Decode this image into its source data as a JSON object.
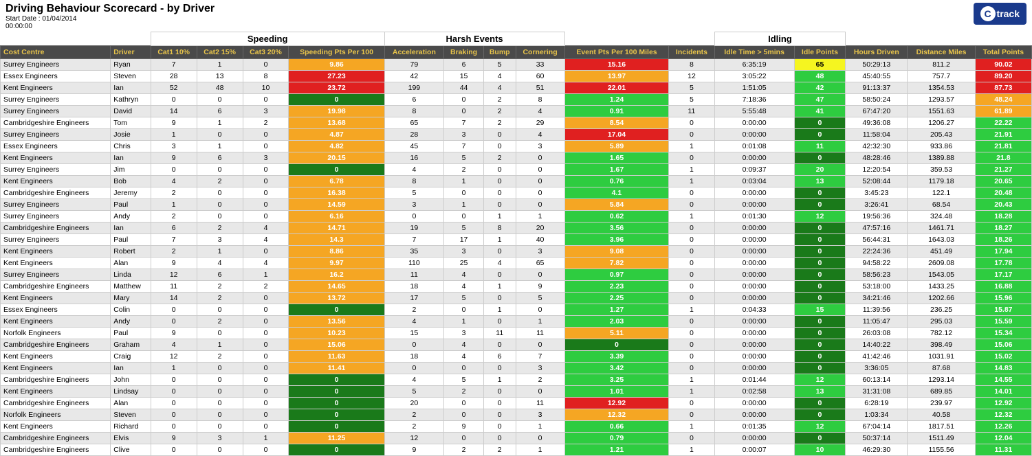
{
  "title": "Driving Behaviour Scorecard - by Driver",
  "startDate": "Start Date : 01/04/2014",
  "startTime": "00:00:00",
  "logo": {
    "letter": "C",
    "text": "track"
  },
  "sectionHeaders": {
    "speeding": "Speeding",
    "harsh": "Harsh Events",
    "idling": "Idling"
  },
  "columnHeaders": {
    "costCentre": "Cost Centre",
    "driver": "Driver",
    "cat1": "Cat1 10%",
    "cat2": "Cat2 15%",
    "cat3": "Cat3 20%",
    "speedingPts": "Speeding Pts Per 100",
    "acceleration": "Acceleration",
    "braking": "Braking",
    "bump": "Bump",
    "cornering": "Cornering",
    "eventPts": "Event Pts Per 100 Miles",
    "incidents": "Incidents",
    "idleTime": "Idle Time > 5mins",
    "idlePoints": "Idle Points",
    "hoursDriven": "Hours Driven",
    "distanceMiles": "Distance Miles",
    "totalPoints": "Total Points"
  },
  "rows": [
    {
      "costCentre": "Surrey Engineers",
      "driver": "Ryan",
      "cat1": 7,
      "cat2": 1,
      "cat3": 0,
      "speedingPts": "9.86",
      "speedingColor": "orange",
      "acceleration": 79,
      "braking": 6,
      "bump": 5,
      "cornering": 33,
      "eventPts": "15.16",
      "eventColor": "red",
      "incidents": 8,
      "idleTime": "6:35:19",
      "idlePoints": 65,
      "idleColor": "yellow",
      "hoursDriven": "50:29:13",
      "distanceMiles": "811.2",
      "totalPoints": "90.02",
      "totalColor": "red"
    },
    {
      "costCentre": "Essex Engineers",
      "driver": "Steven",
      "cat1": 28,
      "cat2": 13,
      "cat3": 8,
      "speedingPts": "27.23",
      "speedingColor": "red",
      "acceleration": 42,
      "braking": 15,
      "bump": 4,
      "cornering": 60,
      "eventPts": "13.97",
      "eventColor": "orange",
      "incidents": 12,
      "idleTime": "3:05:22",
      "idlePoints": 48,
      "idleColor": "green",
      "hoursDriven": "45:40:55",
      "distanceMiles": "757.7",
      "totalPoints": "89.20",
      "totalColor": "red"
    },
    {
      "costCentre": "Kent Engineers",
      "driver": "Ian",
      "cat1": 52,
      "cat2": 48,
      "cat3": 10,
      "speedingPts": "23.72",
      "speedingColor": "red",
      "acceleration": 199,
      "braking": 44,
      "bump": 4,
      "cornering": 51,
      "eventPts": "22.01",
      "eventColor": "red",
      "incidents": 5,
      "idleTime": "1:51:05",
      "idlePoints": 42,
      "idleColor": "green",
      "hoursDriven": "91:13:37",
      "distanceMiles": "1354.53",
      "totalPoints": "87.73",
      "totalColor": "red"
    },
    {
      "costCentre": "Surrey Engineers",
      "driver": "Kathryn",
      "cat1": 0,
      "cat2": 0,
      "cat3": 0,
      "speedingPts": "0",
      "speedingColor": "dark-green",
      "acceleration": 6,
      "braking": 0,
      "bump": 2,
      "cornering": 8,
      "eventPts": "1.24",
      "eventColor": "green",
      "incidents": 5,
      "idleTime": "7:18:36",
      "idlePoints": 47,
      "idleColor": "green",
      "hoursDriven": "58:50:24",
      "distanceMiles": "1293.57",
      "totalPoints": "48.24",
      "totalColor": "orange"
    },
    {
      "costCentre": "Surrey Engineers",
      "driver": "David",
      "cat1": 14,
      "cat2": 6,
      "cat3": 3,
      "speedingPts": "19.98",
      "speedingColor": "orange",
      "acceleration": 8,
      "braking": 0,
      "bump": 2,
      "cornering": 4,
      "eventPts": "0.91",
      "eventColor": "green",
      "incidents": 11,
      "idleTime": "5:55:48",
      "idlePoints": 41,
      "idleColor": "green",
      "hoursDriven": "67:47:20",
      "distanceMiles": "1551.63",
      "totalPoints": "61.89",
      "totalColor": "orange"
    },
    {
      "costCentre": "Cambridgeshire Engineers",
      "driver": "Tom",
      "cat1": 9,
      "cat2": 1,
      "cat3": 2,
      "speedingPts": "13.68",
      "speedingColor": "orange",
      "acceleration": 65,
      "braking": 7,
      "bump": 2,
      "cornering": 29,
      "eventPts": "8.54",
      "eventColor": "orange",
      "incidents": 0,
      "idleTime": "0:00:00",
      "idlePoints": 0,
      "idleColor": "dark-green",
      "hoursDriven": "49:36:08",
      "distanceMiles": "1206.27",
      "totalPoints": "22.22",
      "totalColor": "green"
    },
    {
      "costCentre": "Surrey Engineers",
      "driver": "Josie",
      "cat1": 1,
      "cat2": 0,
      "cat3": 0,
      "speedingPts": "4.87",
      "speedingColor": "orange",
      "acceleration": 28,
      "braking": 3,
      "bump": 0,
      "cornering": 4,
      "eventPts": "17.04",
      "eventColor": "red",
      "incidents": 0,
      "idleTime": "0:00:00",
      "idlePoints": 0,
      "idleColor": "dark-green",
      "hoursDriven": "11:58:04",
      "distanceMiles": "205.43",
      "totalPoints": "21.91",
      "totalColor": "green"
    },
    {
      "costCentre": "Essex Engineers",
      "driver": "Chris",
      "cat1": 3,
      "cat2": 1,
      "cat3": 0,
      "speedingPts": "4.82",
      "speedingColor": "orange",
      "acceleration": 45,
      "braking": 7,
      "bump": 0,
      "cornering": 3,
      "eventPts": "5.89",
      "eventColor": "orange",
      "incidents": 1,
      "idleTime": "0:01:08",
      "idlePoints": 11,
      "idleColor": "green",
      "hoursDriven": "42:32:30",
      "distanceMiles": "933.86",
      "totalPoints": "21.81",
      "totalColor": "green"
    },
    {
      "costCentre": "Kent Engineers",
      "driver": "Ian",
      "cat1": 9,
      "cat2": 6,
      "cat3": 3,
      "speedingPts": "20.15",
      "speedingColor": "orange",
      "acceleration": 16,
      "braking": 5,
      "bump": 2,
      "cornering": 0,
      "eventPts": "1.65",
      "eventColor": "green",
      "incidents": 0,
      "idleTime": "0:00:00",
      "idlePoints": 0,
      "idleColor": "dark-green",
      "hoursDriven": "48:28:46",
      "distanceMiles": "1389.88",
      "totalPoints": "21.8",
      "totalColor": "green"
    },
    {
      "costCentre": "Surrey Engineers",
      "driver": "Jim",
      "cat1": 0,
      "cat2": 0,
      "cat3": 0,
      "speedingPts": "0",
      "speedingColor": "dark-green",
      "acceleration": 4,
      "braking": 2,
      "bump": 0,
      "cornering": 0,
      "eventPts": "1.67",
      "eventColor": "green",
      "incidents": 1,
      "idleTime": "0:09:37",
      "idlePoints": 20,
      "idleColor": "green",
      "hoursDriven": "12:20:54",
      "distanceMiles": "359.53",
      "totalPoints": "21.27",
      "totalColor": "green"
    },
    {
      "costCentre": "Kent Engineers",
      "driver": "Bob",
      "cat1": 4,
      "cat2": 2,
      "cat3": 0,
      "speedingPts": "6.78",
      "speedingColor": "orange",
      "acceleration": 8,
      "braking": 1,
      "bump": 0,
      "cornering": 0,
      "eventPts": "0.76",
      "eventColor": "green",
      "incidents": 1,
      "idleTime": "0:03:04",
      "idlePoints": 13,
      "idleColor": "green",
      "hoursDriven": "52:08:44",
      "distanceMiles": "1179.18",
      "totalPoints": "20.65",
      "totalColor": "green"
    },
    {
      "costCentre": "Cambridgeshire Engineers",
      "driver": "Jeremy",
      "cat1": 2,
      "cat2": 0,
      "cat3": 0,
      "speedingPts": "16.38",
      "speedingColor": "orange",
      "acceleration": 5,
      "braking": 0,
      "bump": 0,
      "cornering": 0,
      "eventPts": "4.1",
      "eventColor": "green",
      "incidents": 0,
      "idleTime": "0:00:00",
      "idlePoints": 0,
      "idleColor": "dark-green",
      "hoursDriven": "3:45:23",
      "distanceMiles": "122.1",
      "totalPoints": "20.48",
      "totalColor": "green"
    },
    {
      "costCentre": "Surrey Engineers",
      "driver": "Paul",
      "cat1": 1,
      "cat2": 0,
      "cat3": 0,
      "speedingPts": "14.59",
      "speedingColor": "orange",
      "acceleration": 3,
      "braking": 1,
      "bump": 0,
      "cornering": 0,
      "eventPts": "5.84",
      "eventColor": "orange",
      "incidents": 0,
      "idleTime": "0:00:00",
      "idlePoints": 0,
      "idleColor": "dark-green",
      "hoursDriven": "3:26:41",
      "distanceMiles": "68.54",
      "totalPoints": "20.43",
      "totalColor": "green"
    },
    {
      "costCentre": "Surrey Engineers",
      "driver": "Andy",
      "cat1": 2,
      "cat2": 0,
      "cat3": 0,
      "speedingPts": "6.16",
      "speedingColor": "orange",
      "acceleration": 0,
      "braking": 0,
      "bump": 1,
      "cornering": 1,
      "eventPts": "0.62",
      "eventColor": "green",
      "incidents": 1,
      "idleTime": "0:01:30",
      "idlePoints": 12,
      "idleColor": "green",
      "hoursDriven": "19:56:36",
      "distanceMiles": "324.48",
      "totalPoints": "18.28",
      "totalColor": "green"
    },
    {
      "costCentre": "Cambridgeshire Engineers",
      "driver": "Ian",
      "cat1": 6,
      "cat2": 2,
      "cat3": 4,
      "speedingPts": "14.71",
      "speedingColor": "orange",
      "acceleration": 19,
      "braking": 5,
      "bump": 8,
      "cornering": 20,
      "eventPts": "3.56",
      "eventColor": "green",
      "incidents": 0,
      "idleTime": "0:00:00",
      "idlePoints": 0,
      "idleColor": "dark-green",
      "hoursDriven": "47:57:16",
      "distanceMiles": "1461.71",
      "totalPoints": "18.27",
      "totalColor": "green"
    },
    {
      "costCentre": "Surrey Engineers",
      "driver": "Paul",
      "cat1": 7,
      "cat2": 3,
      "cat3": 4,
      "speedingPts": "14.3",
      "speedingColor": "orange",
      "acceleration": 7,
      "braking": 17,
      "bump": 1,
      "cornering": 40,
      "eventPts": "3.96",
      "eventColor": "green",
      "incidents": 0,
      "idleTime": "0:00:00",
      "idlePoints": 0,
      "idleColor": "dark-green",
      "hoursDriven": "56:44:31",
      "distanceMiles": "1643.03",
      "totalPoints": "18.26",
      "totalColor": "green"
    },
    {
      "costCentre": "Kent Engineers",
      "driver": "Robert",
      "cat1": 2,
      "cat2": 1,
      "cat3": 0,
      "speedingPts": "8.86",
      "speedingColor": "orange",
      "acceleration": 35,
      "braking": 3,
      "bump": 0,
      "cornering": 3,
      "eventPts": "9.08",
      "eventColor": "orange",
      "incidents": 0,
      "idleTime": "0:00:00",
      "idlePoints": 0,
      "idleColor": "dark-green",
      "hoursDriven": "22:24:36",
      "distanceMiles": "451.49",
      "totalPoints": "17.94",
      "totalColor": "green"
    },
    {
      "costCentre": "Kent Engineers",
      "driver": "Alan",
      "cat1": 9,
      "cat2": 4,
      "cat3": 4,
      "speedingPts": "9.97",
      "speedingColor": "orange",
      "acceleration": 110,
      "braking": 25,
      "bump": 4,
      "cornering": 65,
      "eventPts": "7.82",
      "eventColor": "orange",
      "incidents": 0,
      "idleTime": "0:00:00",
      "idlePoints": 0,
      "idleColor": "dark-green",
      "hoursDriven": "94:58:22",
      "distanceMiles": "2609.08",
      "totalPoints": "17.78",
      "totalColor": "green"
    },
    {
      "costCentre": "Surrey Engineers",
      "driver": "Linda",
      "cat1": 12,
      "cat2": 6,
      "cat3": 1,
      "speedingPts": "16.2",
      "speedingColor": "orange",
      "acceleration": 11,
      "braking": 4,
      "bump": 0,
      "cornering": 0,
      "eventPts": "0.97",
      "eventColor": "green",
      "incidents": 0,
      "idleTime": "0:00:00",
      "idlePoints": 0,
      "idleColor": "dark-green",
      "hoursDriven": "58:56:23",
      "distanceMiles": "1543.05",
      "totalPoints": "17.17",
      "totalColor": "green"
    },
    {
      "costCentre": "Cambridgeshire Engineers",
      "driver": "Matthew",
      "cat1": 11,
      "cat2": 2,
      "cat3": 2,
      "speedingPts": "14.65",
      "speedingColor": "orange",
      "acceleration": 18,
      "braking": 4,
      "bump": 1,
      "cornering": 9,
      "eventPts": "2.23",
      "eventColor": "green",
      "incidents": 0,
      "idleTime": "0:00:00",
      "idlePoints": 0,
      "idleColor": "dark-green",
      "hoursDriven": "53:18:00",
      "distanceMiles": "1433.25",
      "totalPoints": "16.88",
      "totalColor": "green"
    },
    {
      "costCentre": "Kent Engineers",
      "driver": "Mary",
      "cat1": 14,
      "cat2": 2,
      "cat3": 0,
      "speedingPts": "13.72",
      "speedingColor": "orange",
      "acceleration": 17,
      "braking": 5,
      "bump": 0,
      "cornering": 5,
      "eventPts": "2.25",
      "eventColor": "green",
      "incidents": 0,
      "idleTime": "0:00:00",
      "idlePoints": 0,
      "idleColor": "dark-green",
      "hoursDriven": "34:21:46",
      "distanceMiles": "1202.66",
      "totalPoints": "15.96",
      "totalColor": "green"
    },
    {
      "costCentre": "Essex Engineers",
      "driver": "Colin",
      "cat1": 0,
      "cat2": 0,
      "cat3": 0,
      "speedingPts": "0",
      "speedingColor": "dark-green",
      "acceleration": 2,
      "braking": 0,
      "bump": 1,
      "cornering": 0,
      "eventPts": "1.27",
      "eventColor": "green",
      "incidents": 1,
      "idleTime": "0:04:33",
      "idlePoints": 15,
      "idleColor": "green",
      "hoursDriven": "11:39:56",
      "distanceMiles": "236.25",
      "totalPoints": "15.87",
      "totalColor": "green"
    },
    {
      "costCentre": "Kent Engineers",
      "driver": "Andy",
      "cat1": 0,
      "cat2": 2,
      "cat3": 0,
      "speedingPts": "13.56",
      "speedingColor": "orange",
      "acceleration": 4,
      "braking": 1,
      "bump": 0,
      "cornering": 1,
      "eventPts": "2.03",
      "eventColor": "green",
      "incidents": 0,
      "idleTime": "0:00:00",
      "idlePoints": 0,
      "idleColor": "dark-green",
      "hoursDriven": "11:05:47",
      "distanceMiles": "295.03",
      "totalPoints": "15.59",
      "totalColor": "green"
    },
    {
      "costCentre": "Norfolk Engineers",
      "driver": "Paul",
      "cat1": 9,
      "cat2": 0,
      "cat3": 0,
      "speedingPts": "10.23",
      "speedingColor": "orange",
      "acceleration": 15,
      "braking": 3,
      "bump": 11,
      "cornering": 11,
      "eventPts": "5.11",
      "eventColor": "orange",
      "incidents": 0,
      "idleTime": "0:00:00",
      "idlePoints": 0,
      "idleColor": "dark-green",
      "hoursDriven": "26:03:08",
      "distanceMiles": "782.12",
      "totalPoints": "15.34",
      "totalColor": "green"
    },
    {
      "costCentre": "Cambridgeshire Engineers",
      "driver": "Graham",
      "cat1": 4,
      "cat2": 1,
      "cat3": 0,
      "speedingPts": "15.06",
      "speedingColor": "orange",
      "acceleration": 0,
      "braking": 4,
      "bump": 0,
      "cornering": 0,
      "eventPts": "0",
      "eventColor": "dark-green",
      "incidents": 0,
      "idleTime": "0:00:00",
      "idlePoints": 0,
      "idleColor": "dark-green",
      "hoursDriven": "14:40:22",
      "distanceMiles": "398.49",
      "totalPoints": "15.06",
      "totalColor": "green"
    },
    {
      "costCentre": "Kent Engineers",
      "driver": "Craig",
      "cat1": 12,
      "cat2": 2,
      "cat3": 0,
      "speedingPts": "11.63",
      "speedingColor": "orange",
      "acceleration": 18,
      "braking": 4,
      "bump": 6,
      "cornering": 7,
      "eventPts": "3.39",
      "eventColor": "green",
      "incidents": 0,
      "idleTime": "0:00:00",
      "idlePoints": 0,
      "idleColor": "dark-green",
      "hoursDriven": "41:42:46",
      "distanceMiles": "1031.91",
      "totalPoints": "15.02",
      "totalColor": "green"
    },
    {
      "costCentre": "Kent Engineers",
      "driver": "Ian",
      "cat1": 1,
      "cat2": 0,
      "cat3": 0,
      "speedingPts": "11.41",
      "speedingColor": "orange",
      "acceleration": 0,
      "braking": 0,
      "bump": 0,
      "cornering": 3,
      "eventPts": "3.42",
      "eventColor": "green",
      "incidents": 0,
      "idleTime": "0:00:00",
      "idlePoints": 0,
      "idleColor": "dark-green",
      "hoursDriven": "3:36:05",
      "distanceMiles": "87.68",
      "totalPoints": "14.83",
      "totalColor": "green"
    },
    {
      "costCentre": "Cambridgeshire Engineers",
      "driver": "John",
      "cat1": 0,
      "cat2": 0,
      "cat3": 0,
      "speedingPts": "0",
      "speedingColor": "dark-green",
      "acceleration": 4,
      "braking": 5,
      "bump": 1,
      "cornering": 2,
      "eventPts": "3.25",
      "eventColor": "green",
      "incidents": 1,
      "idleTime": "0:01:44",
      "idlePoints": 12,
      "idleColor": "green",
      "hoursDriven": "60:13:14",
      "distanceMiles": "1293.14",
      "totalPoints": "14.55",
      "totalColor": "green"
    },
    {
      "costCentre": "Kent Engineers",
      "driver": "Lindsay",
      "cat1": 0,
      "cat2": 0,
      "cat3": 0,
      "speedingPts": "0",
      "speedingColor": "dark-green",
      "acceleration": 5,
      "braking": 2,
      "bump": 0,
      "cornering": 0,
      "eventPts": "1.01",
      "eventColor": "green",
      "incidents": 1,
      "idleTime": "0:02:58",
      "idlePoints": 13,
      "idleColor": "green",
      "hoursDriven": "31:31:08",
      "distanceMiles": "689.85",
      "totalPoints": "14.01",
      "totalColor": "green"
    },
    {
      "costCentre": "Cambridgeshire Engineers",
      "driver": "Alan",
      "cat1": 0,
      "cat2": 0,
      "cat3": 0,
      "speedingPts": "0",
      "speedingColor": "dark-green",
      "acceleration": 20,
      "braking": 0,
      "bump": 0,
      "cornering": 11,
      "eventPts": "12.92",
      "eventColor": "red",
      "incidents": 0,
      "idleTime": "0:00:00",
      "idlePoints": 0,
      "idleColor": "dark-green",
      "hoursDriven": "6:28:19",
      "distanceMiles": "239.97",
      "totalPoints": "12.92",
      "totalColor": "green"
    },
    {
      "costCentre": "Norfolk Engineers",
      "driver": "Steven",
      "cat1": 0,
      "cat2": 0,
      "cat3": 0,
      "speedingPts": "0",
      "speedingColor": "dark-green",
      "acceleration": 2,
      "braking": 0,
      "bump": 0,
      "cornering": 3,
      "eventPts": "12.32",
      "eventColor": "orange",
      "incidents": 0,
      "idleTime": "0:00:00",
      "idlePoints": 0,
      "idleColor": "dark-green",
      "hoursDriven": "1:03:34",
      "distanceMiles": "40.58",
      "totalPoints": "12.32",
      "totalColor": "green"
    },
    {
      "costCentre": "Kent Engineers",
      "driver": "Richard",
      "cat1": 0,
      "cat2": 0,
      "cat3": 0,
      "speedingPts": "0",
      "speedingColor": "dark-green",
      "acceleration": 2,
      "braking": 9,
      "bump": 0,
      "cornering": 1,
      "eventPts": "0.66",
      "eventColor": "green",
      "incidents": 1,
      "idleTime": "0:01:35",
      "idlePoints": 12,
      "idleColor": "green",
      "hoursDriven": "67:04:14",
      "distanceMiles": "1817.51",
      "totalPoints": "12.26",
      "totalColor": "green"
    },
    {
      "costCentre": "Cambridgeshire Engineers",
      "driver": "Elvis",
      "cat1": 9,
      "cat2": 3,
      "cat3": 1,
      "speedingPts": "11.25",
      "speedingColor": "orange",
      "acceleration": 12,
      "braking": 0,
      "bump": 0,
      "cornering": 0,
      "eventPts": "0.79",
      "eventColor": "green",
      "incidents": 0,
      "idleTime": "0:00:00",
      "idlePoints": 0,
      "idleColor": "dark-green",
      "hoursDriven": "50:37:14",
      "distanceMiles": "1511.49",
      "totalPoints": "12.04",
      "totalColor": "green"
    },
    {
      "costCentre": "Cambridgeshire Engineers",
      "driver": "Clive",
      "cat1": 0,
      "cat2": 0,
      "cat3": 0,
      "speedingPts": "0",
      "speedingColor": "dark-green",
      "acceleration": 9,
      "braking": 2,
      "bump": 2,
      "cornering": 1,
      "eventPts": "1.21",
      "eventColor": "green",
      "incidents": 1,
      "idleTime": "0:00:07",
      "idlePoints": 10,
      "idleColor": "green",
      "hoursDriven": "46:29:30",
      "distanceMiles": "1155.56",
      "totalPoints": "11.31",
      "totalColor": "green"
    }
  ]
}
